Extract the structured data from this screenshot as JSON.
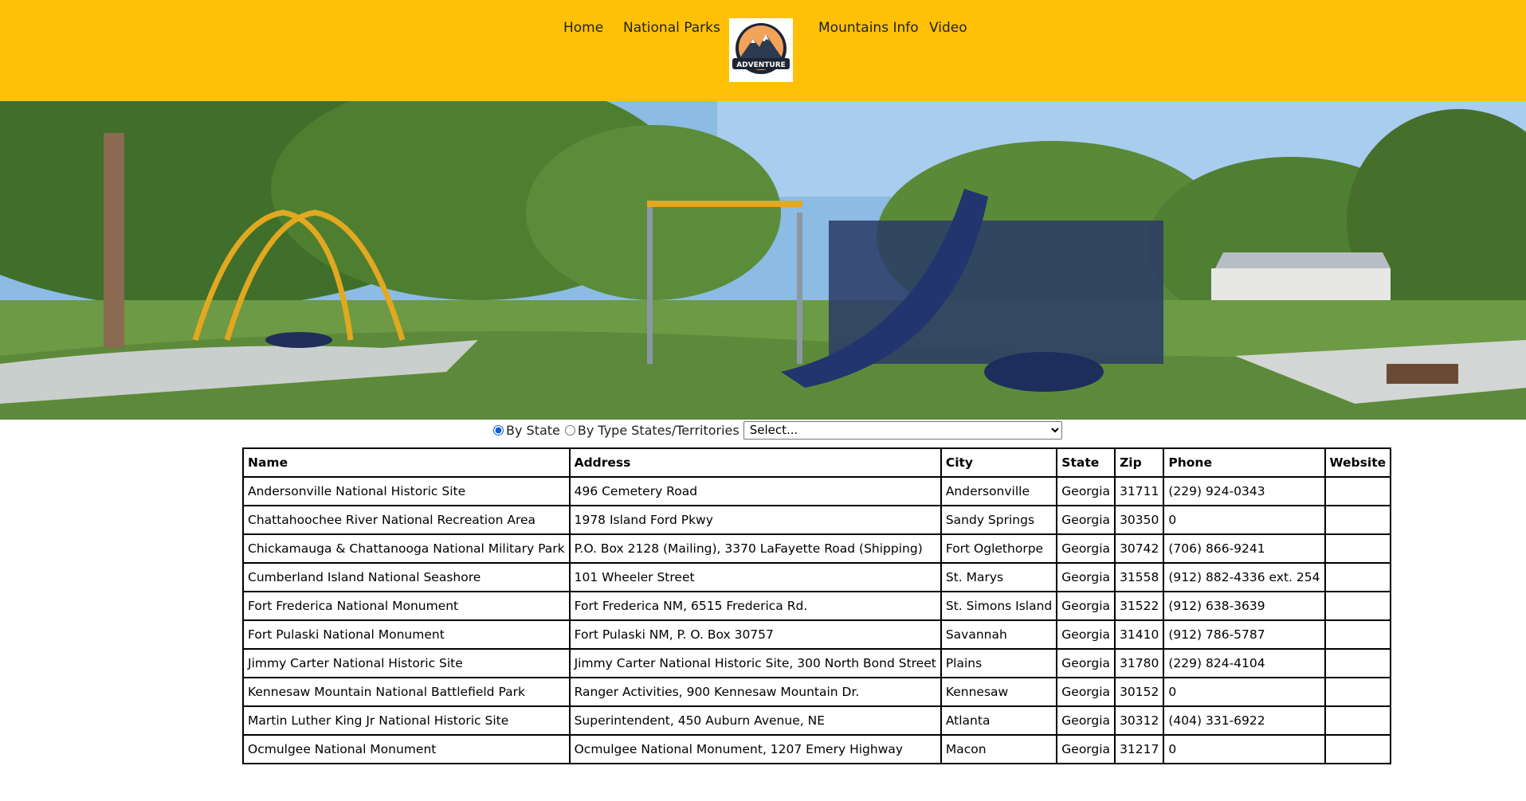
{
  "nav": {
    "home": "Home",
    "national_parks": "National Parks",
    "mountains_info": "Mountains Info",
    "video": "Video",
    "logo_text": "ADVENTURE"
  },
  "filter": {
    "by_state_label": "By State",
    "by_type_label": "By Type",
    "select_label": "States/Territories",
    "select_value": "Select...",
    "selected_option": "By State"
  },
  "table": {
    "headers": [
      "Name",
      "Address",
      "City",
      "State",
      "Zip",
      "Phone",
      "Website"
    ],
    "rows": [
      [
        "Andersonville National Historic Site",
        "496 Cemetery Road",
        "Andersonville",
        "Georgia",
        "31711",
        "(229) 924-0343",
        ""
      ],
      [
        "Chattahoochee River National Recreation Area",
        "1978 Island Ford Pkwy",
        "Sandy Springs",
        "Georgia",
        "30350",
        "0",
        ""
      ],
      [
        "Chickamauga & Chattanooga National Military Park",
        "P.O. Box 2128 (Mailing), 3370 LaFayette Road (Shipping)",
        "Fort Oglethorpe",
        "Georgia",
        "30742",
        "(706) 866-9241",
        ""
      ],
      [
        "Cumberland Island National Seashore",
        "101 Wheeler Street",
        "St. Marys",
        "Georgia",
        "31558",
        "(912) 882-4336 ext. 254",
        ""
      ],
      [
        "Fort Frederica National Monument",
        "Fort Frederica NM, 6515 Frederica Rd.",
        "St. Simons Island",
        "Georgia",
        "31522",
        "(912) 638-3639",
        ""
      ],
      [
        "Fort Pulaski National Monument",
        "Fort Pulaski NM, P. O. Box 30757",
        "Savannah",
        "Georgia",
        "31410",
        "(912) 786-5787",
        ""
      ],
      [
        "Jimmy Carter National Historic Site",
        "Jimmy Carter National Historic Site, 300 North Bond Street",
        "Plains",
        "Georgia",
        "31780",
        "(229) 824-4104",
        ""
      ],
      [
        "Kennesaw Mountain National Battlefield Park",
        "Ranger Activities, 900 Kennesaw Mountain Dr.",
        "Kennesaw",
        "Georgia",
        "30152",
        "0",
        ""
      ],
      [
        "Martin Luther King Jr National Historic Site",
        "Superintendent, 450 Auburn Avenue, NE",
        "Atlanta",
        "Georgia",
        "30312",
        "(404) 331-6922",
        ""
      ],
      [
        "Ocmulgee National Monument",
        "Ocmulgee National Monument, 1207 Emery Highway",
        "Macon",
        "Georgia",
        "31217",
        "0",
        ""
      ]
    ]
  },
  "colors": {
    "header_bg": "#ffc107",
    "text": "#222222",
    "border": "#000000"
  }
}
